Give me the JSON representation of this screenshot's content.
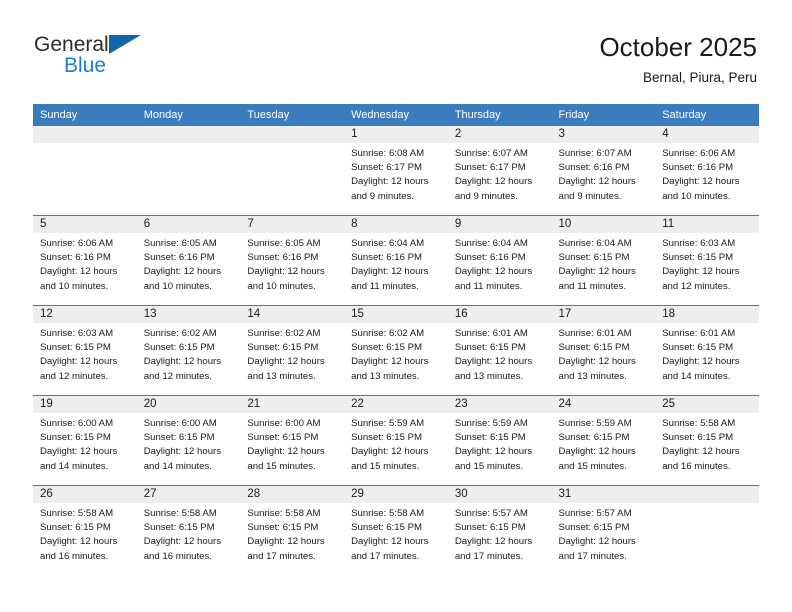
{
  "brand": {
    "name_part1": "General",
    "name_part2": "Blue",
    "triangle_color": "#1266b0",
    "blue_text_color": "#1b7fd4"
  },
  "header": {
    "title": "October 2025",
    "subtitle": "Bernal, Piura, Peru"
  },
  "theme": {
    "header_blue": "#3a7cbe",
    "daynum_band": "#eeeeee",
    "row_divider": "#3a7cbe",
    "text": "#1a1a1a"
  },
  "weekdays": [
    "Sunday",
    "Monday",
    "Tuesday",
    "Wednesday",
    "Thursday",
    "Friday",
    "Saturday"
  ],
  "labels": {
    "sunrise_prefix": "Sunrise: ",
    "sunset_prefix": "Sunset: ",
    "daylight_prefix": "Daylight: "
  },
  "weeks": [
    [
      {
        "empty": true
      },
      {
        "empty": true
      },
      {
        "empty": true
      },
      {
        "day": "1",
        "sunrise": "Sunrise: 6:08 AM",
        "sunset": "Sunset: 6:17 PM",
        "daylight_l1": "Daylight: 12 hours",
        "daylight_l2": "and 9 minutes."
      },
      {
        "day": "2",
        "sunrise": "Sunrise: 6:07 AM",
        "sunset": "Sunset: 6:17 PM",
        "daylight_l1": "Daylight: 12 hours",
        "daylight_l2": "and 9 minutes."
      },
      {
        "day": "3",
        "sunrise": "Sunrise: 6:07 AM",
        "sunset": "Sunset: 6:16 PM",
        "daylight_l1": "Daylight: 12 hours",
        "daylight_l2": "and 9 minutes."
      },
      {
        "day": "4",
        "sunrise": "Sunrise: 6:06 AM",
        "sunset": "Sunset: 6:16 PM",
        "daylight_l1": "Daylight: 12 hours",
        "daylight_l2": "and 10 minutes."
      }
    ],
    [
      {
        "day": "5",
        "sunrise": "Sunrise: 6:06 AM",
        "sunset": "Sunset: 6:16 PM",
        "daylight_l1": "Daylight: 12 hours",
        "daylight_l2": "and 10 minutes."
      },
      {
        "day": "6",
        "sunrise": "Sunrise: 6:05 AM",
        "sunset": "Sunset: 6:16 PM",
        "daylight_l1": "Daylight: 12 hours",
        "daylight_l2": "and 10 minutes."
      },
      {
        "day": "7",
        "sunrise": "Sunrise: 6:05 AM",
        "sunset": "Sunset: 6:16 PM",
        "daylight_l1": "Daylight: 12 hours",
        "daylight_l2": "and 10 minutes."
      },
      {
        "day": "8",
        "sunrise": "Sunrise: 6:04 AM",
        "sunset": "Sunset: 6:16 PM",
        "daylight_l1": "Daylight: 12 hours",
        "daylight_l2": "and 11 minutes."
      },
      {
        "day": "9",
        "sunrise": "Sunrise: 6:04 AM",
        "sunset": "Sunset: 6:16 PM",
        "daylight_l1": "Daylight: 12 hours",
        "daylight_l2": "and 11 minutes."
      },
      {
        "day": "10",
        "sunrise": "Sunrise: 6:04 AM",
        "sunset": "Sunset: 6:15 PM",
        "daylight_l1": "Daylight: 12 hours",
        "daylight_l2": "and 11 minutes."
      },
      {
        "day": "11",
        "sunrise": "Sunrise: 6:03 AM",
        "sunset": "Sunset: 6:15 PM",
        "daylight_l1": "Daylight: 12 hours",
        "daylight_l2": "and 12 minutes."
      }
    ],
    [
      {
        "day": "12",
        "sunrise": "Sunrise: 6:03 AM",
        "sunset": "Sunset: 6:15 PM",
        "daylight_l1": "Daylight: 12 hours",
        "daylight_l2": "and 12 minutes."
      },
      {
        "day": "13",
        "sunrise": "Sunrise: 6:02 AM",
        "sunset": "Sunset: 6:15 PM",
        "daylight_l1": "Daylight: 12 hours",
        "daylight_l2": "and 12 minutes."
      },
      {
        "day": "14",
        "sunrise": "Sunrise: 6:02 AM",
        "sunset": "Sunset: 6:15 PM",
        "daylight_l1": "Daylight: 12 hours",
        "daylight_l2": "and 13 minutes."
      },
      {
        "day": "15",
        "sunrise": "Sunrise: 6:02 AM",
        "sunset": "Sunset: 6:15 PM",
        "daylight_l1": "Daylight: 12 hours",
        "daylight_l2": "and 13 minutes."
      },
      {
        "day": "16",
        "sunrise": "Sunrise: 6:01 AM",
        "sunset": "Sunset: 6:15 PM",
        "daylight_l1": "Daylight: 12 hours",
        "daylight_l2": "and 13 minutes."
      },
      {
        "day": "17",
        "sunrise": "Sunrise: 6:01 AM",
        "sunset": "Sunset: 6:15 PM",
        "daylight_l1": "Daylight: 12 hours",
        "daylight_l2": "and 13 minutes."
      },
      {
        "day": "18",
        "sunrise": "Sunrise: 6:01 AM",
        "sunset": "Sunset: 6:15 PM",
        "daylight_l1": "Daylight: 12 hours",
        "daylight_l2": "and 14 minutes."
      }
    ],
    [
      {
        "day": "19",
        "sunrise": "Sunrise: 6:00 AM",
        "sunset": "Sunset: 6:15 PM",
        "daylight_l1": "Daylight: 12 hours",
        "daylight_l2": "and 14 minutes."
      },
      {
        "day": "20",
        "sunrise": "Sunrise: 6:00 AM",
        "sunset": "Sunset: 6:15 PM",
        "daylight_l1": "Daylight: 12 hours",
        "daylight_l2": "and 14 minutes."
      },
      {
        "day": "21",
        "sunrise": "Sunrise: 6:00 AM",
        "sunset": "Sunset: 6:15 PM",
        "daylight_l1": "Daylight: 12 hours",
        "daylight_l2": "and 15 minutes."
      },
      {
        "day": "22",
        "sunrise": "Sunrise: 5:59 AM",
        "sunset": "Sunset: 6:15 PM",
        "daylight_l1": "Daylight: 12 hours",
        "daylight_l2": "and 15 minutes."
      },
      {
        "day": "23",
        "sunrise": "Sunrise: 5:59 AM",
        "sunset": "Sunset: 6:15 PM",
        "daylight_l1": "Daylight: 12 hours",
        "daylight_l2": "and 15 minutes."
      },
      {
        "day": "24",
        "sunrise": "Sunrise: 5:59 AM",
        "sunset": "Sunset: 6:15 PM",
        "daylight_l1": "Daylight: 12 hours",
        "daylight_l2": "and 15 minutes."
      },
      {
        "day": "25",
        "sunrise": "Sunrise: 5:58 AM",
        "sunset": "Sunset: 6:15 PM",
        "daylight_l1": "Daylight: 12 hours",
        "daylight_l2": "and 16 minutes."
      }
    ],
    [
      {
        "day": "26",
        "sunrise": "Sunrise: 5:58 AM",
        "sunset": "Sunset: 6:15 PM",
        "daylight_l1": "Daylight: 12 hours",
        "daylight_l2": "and 16 minutes."
      },
      {
        "day": "27",
        "sunrise": "Sunrise: 5:58 AM",
        "sunset": "Sunset: 6:15 PM",
        "daylight_l1": "Daylight: 12 hours",
        "daylight_l2": "and 16 minutes."
      },
      {
        "day": "28",
        "sunrise": "Sunrise: 5:58 AM",
        "sunset": "Sunset: 6:15 PM",
        "daylight_l1": "Daylight: 12 hours",
        "daylight_l2": "and 17 minutes."
      },
      {
        "day": "29",
        "sunrise": "Sunrise: 5:58 AM",
        "sunset": "Sunset: 6:15 PM",
        "daylight_l1": "Daylight: 12 hours",
        "daylight_l2": "and 17 minutes."
      },
      {
        "day": "30",
        "sunrise": "Sunrise: 5:57 AM",
        "sunset": "Sunset: 6:15 PM",
        "daylight_l1": "Daylight: 12 hours",
        "daylight_l2": "and 17 minutes."
      },
      {
        "day": "31",
        "sunrise": "Sunrise: 5:57 AM",
        "sunset": "Sunset: 6:15 PM",
        "daylight_l1": "Daylight: 12 hours",
        "daylight_l2": "and 17 minutes."
      },
      {
        "empty": true
      }
    ]
  ]
}
